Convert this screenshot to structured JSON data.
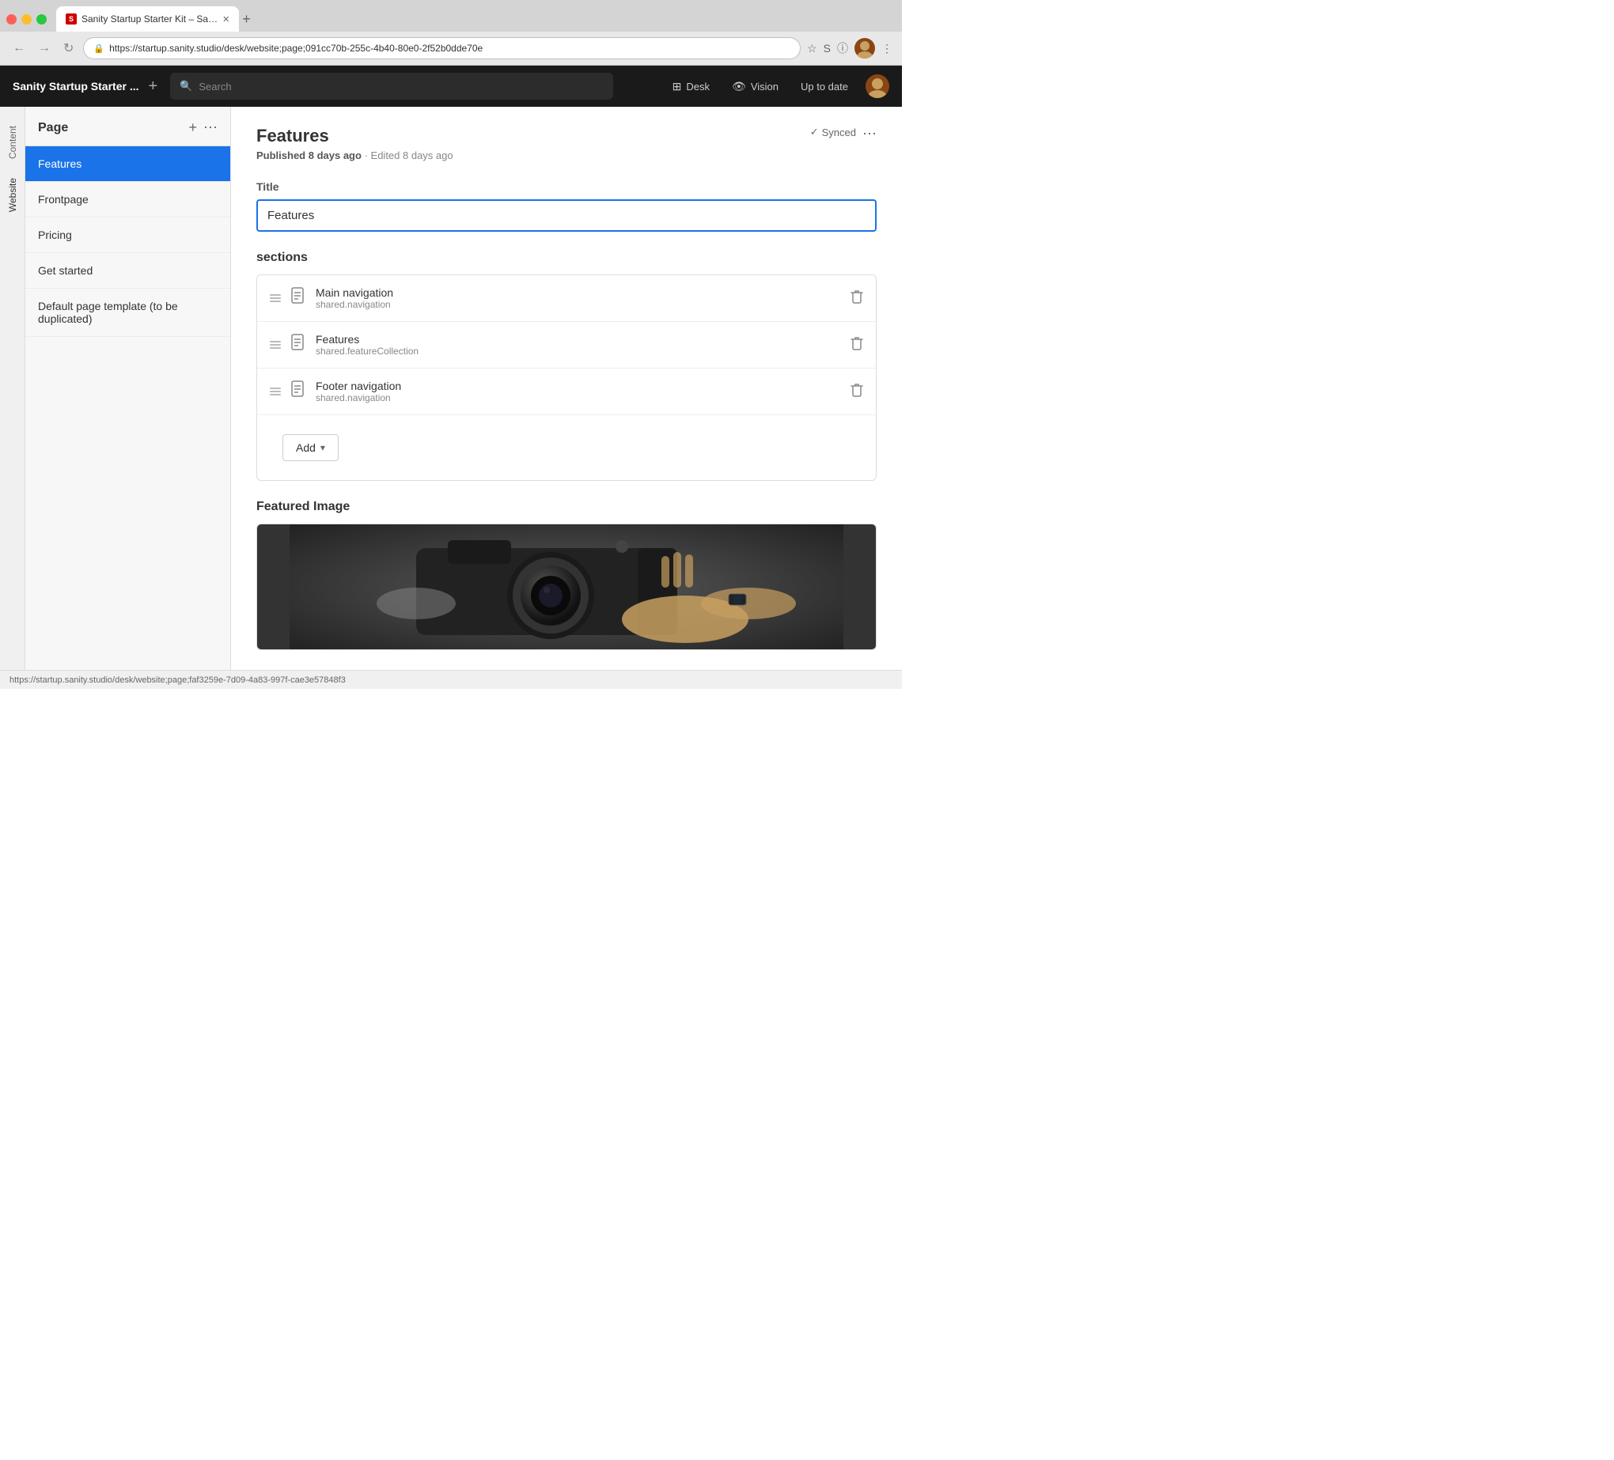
{
  "browser": {
    "tab_title": "Sanity Startup Starter Kit – Sa…",
    "favicon_text": "S",
    "url": "https://startup.sanity.studio/desk/website;page;091cc70b-255c-4b40-80e0-2f52b0dde70e",
    "status_url": "https://startup.sanity.studio/desk/website;page;faf3259e-7d09-4a83-997f-cae3e57848f3"
  },
  "app": {
    "title": "Sanity Startup Starter ...",
    "search_placeholder": "Search",
    "nav_items": [
      {
        "icon": "⊞",
        "label": "Desk"
      },
      {
        "icon": "👁",
        "label": "Vision"
      },
      {
        "label": "Up to date"
      }
    ]
  },
  "sidebar": {
    "tabs": [
      {
        "label": "Content",
        "active": false
      },
      {
        "label": "Website",
        "active": true
      }
    ]
  },
  "page_list": {
    "title": "Page",
    "add_label": "+",
    "more_label": "⋯",
    "items": [
      {
        "label": "Features",
        "active": true
      },
      {
        "label": "Frontpage",
        "active": false
      },
      {
        "label": "Pricing",
        "active": false
      },
      {
        "label": "Get started",
        "active": false
      },
      {
        "label": "Default page template (to be duplicated)",
        "active": false
      }
    ]
  },
  "content": {
    "title": "Features",
    "synced_label": "Synced",
    "more_label": "⋯",
    "check_icon": "✓",
    "meta_published": "Published 8 days ago",
    "meta_edited": "Edited 8 days ago",
    "meta_separator": "·",
    "title_field_label": "Title",
    "title_field_value": "Features",
    "sections_label": "sections",
    "sections": [
      {
        "name": "Main navigation",
        "type": "shared.navigation"
      },
      {
        "name": "Features",
        "type": "shared.featureCollection"
      },
      {
        "name": "Footer navigation",
        "type": "shared.navigation"
      }
    ],
    "add_button_label": "Add",
    "featured_image_label": "Featured Image"
  }
}
